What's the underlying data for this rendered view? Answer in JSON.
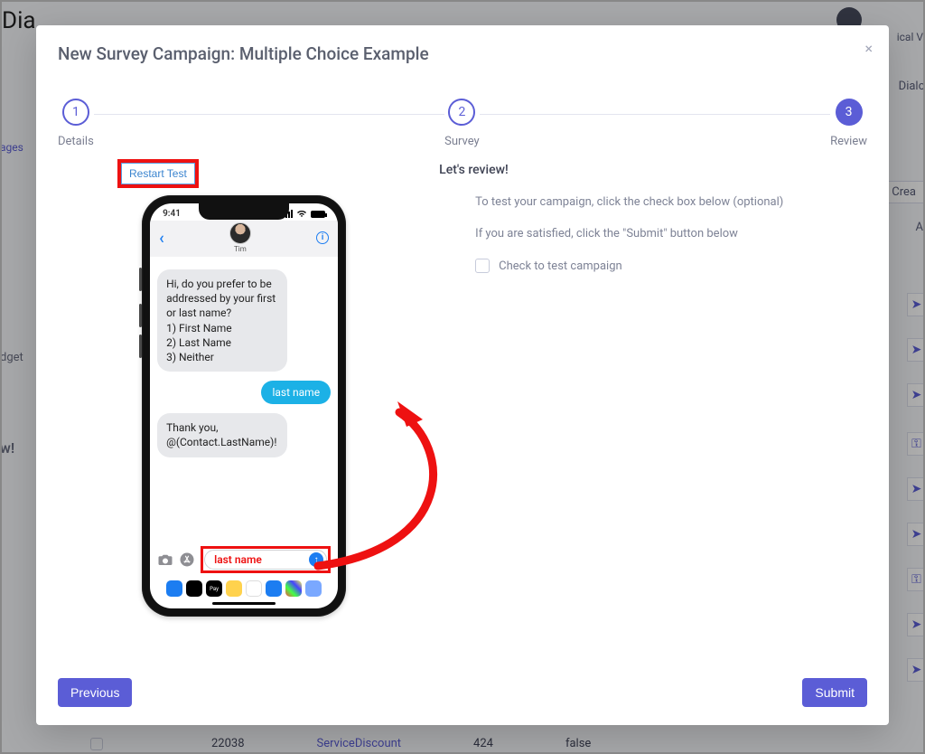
{
  "background": {
    "partial_title": "Dia",
    "right_word": "ical V",
    "left_ages": "ages",
    "left_dget": "dget",
    "left_w": "w!",
    "right_dialo": "Dialo",
    "right_create": "Crea",
    "right_a": "A",
    "table": {
      "col1": "22038",
      "col2": "ServiceDiscount",
      "col3": "424",
      "col4": "false"
    }
  },
  "modal": {
    "title": "New Survey Campaign: Multiple Choice Example",
    "steps": [
      {
        "num": "1",
        "label": "Details"
      },
      {
        "num": "2",
        "label": "Survey"
      },
      {
        "num": "3",
        "label": "Review"
      }
    ],
    "review": {
      "heading": "Let's review!",
      "line1": "To test your campaign, click the check box below (optional)",
      "line2": "If you are satisfied, click the \"Submit\" button below",
      "checkbox_label": "Check to test campaign"
    },
    "buttons": {
      "previous": "Previous",
      "submit": "Submit"
    }
  },
  "phone": {
    "restart_label": "Restart Test",
    "time": "9:41",
    "contact_name": "Tim",
    "msg_question": "Hi, do you prefer to be addressed by your first or last name?\n1) First Name\n2) Last Name\n3) Neither",
    "msg_reply": "last name",
    "msg_thanks": "Thank you, @(Contact.LastName)!",
    "input_value": "last name"
  },
  "icons": {
    "send_glyph": "↑",
    "back_glyph": "‹",
    "info_glyph": "i",
    "paperplane": "➤",
    "key": "⚿"
  }
}
